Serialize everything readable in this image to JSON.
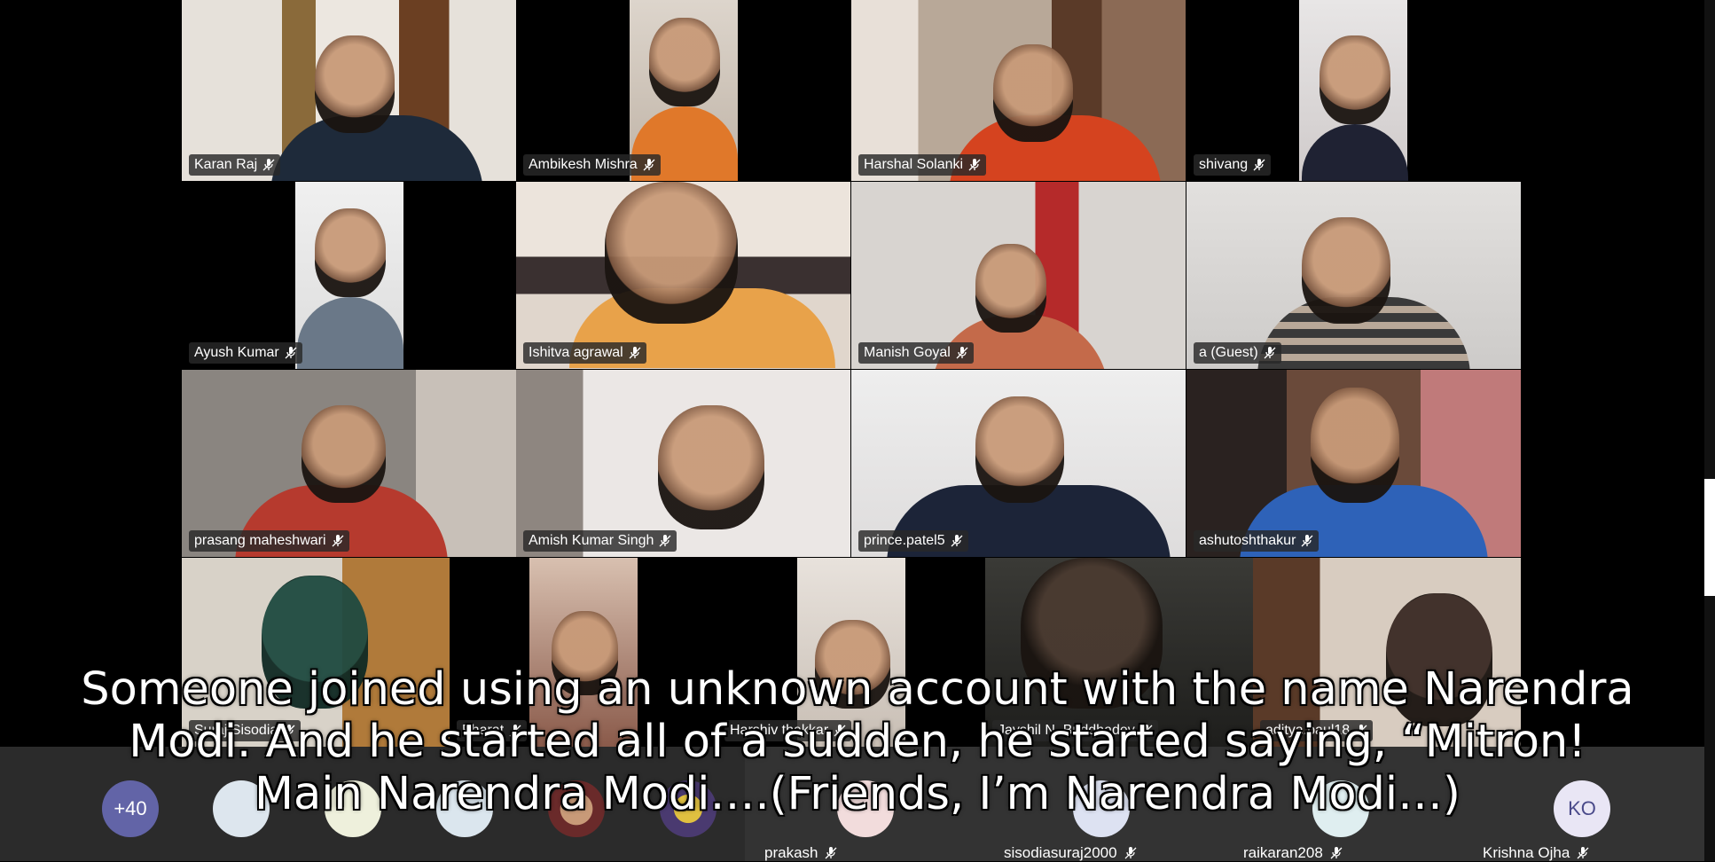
{
  "tiles": [
    {
      "name": "Karan Raj"
    },
    {
      "name": "Ambikesh Mishra"
    },
    {
      "name": "Harshal Solanki"
    },
    {
      "name": "shivang"
    },
    {
      "name": "Ayush Kumar"
    },
    {
      "name": "Ishitva agrawal"
    },
    {
      "name": "Manish Goyal"
    },
    {
      "name": "a (Guest)"
    },
    {
      "name": "prasang maheshwari"
    },
    {
      "name": "Amish Kumar Singh"
    },
    {
      "name": "prince.patel5"
    },
    {
      "name": "ashutoshthakur"
    },
    {
      "name": "Suraj Sisodia"
    },
    {
      "name": "Bharat"
    },
    {
      "name": "Harshiv thakkar"
    },
    {
      "name": "Jayshil N. Buddhadev"
    },
    {
      "name": "aditya.paul18"
    }
  ],
  "strip": {
    "overflow_count": "+40",
    "ko_initials": "KO",
    "names": [
      "prakash",
      "sisodiasuraj2000",
      "raikaran208",
      "Krishna Ojha"
    ]
  },
  "caption": {
    "line1": "Someone joined using an unknown account with the name Narendra",
    "line2": "Modi. And he started all of  a sudden, he started saying, “Mitron!",
    "line3": "Main Narendra Modi….(Friends, I’m Narendra Modi…)"
  },
  "colors": {
    "overflow_avatar": "#6264a7",
    "ko_avatar": "#e9e6f5",
    "ko_text": "#4a4a8a",
    "strip_bg": "#2b2b2b"
  }
}
